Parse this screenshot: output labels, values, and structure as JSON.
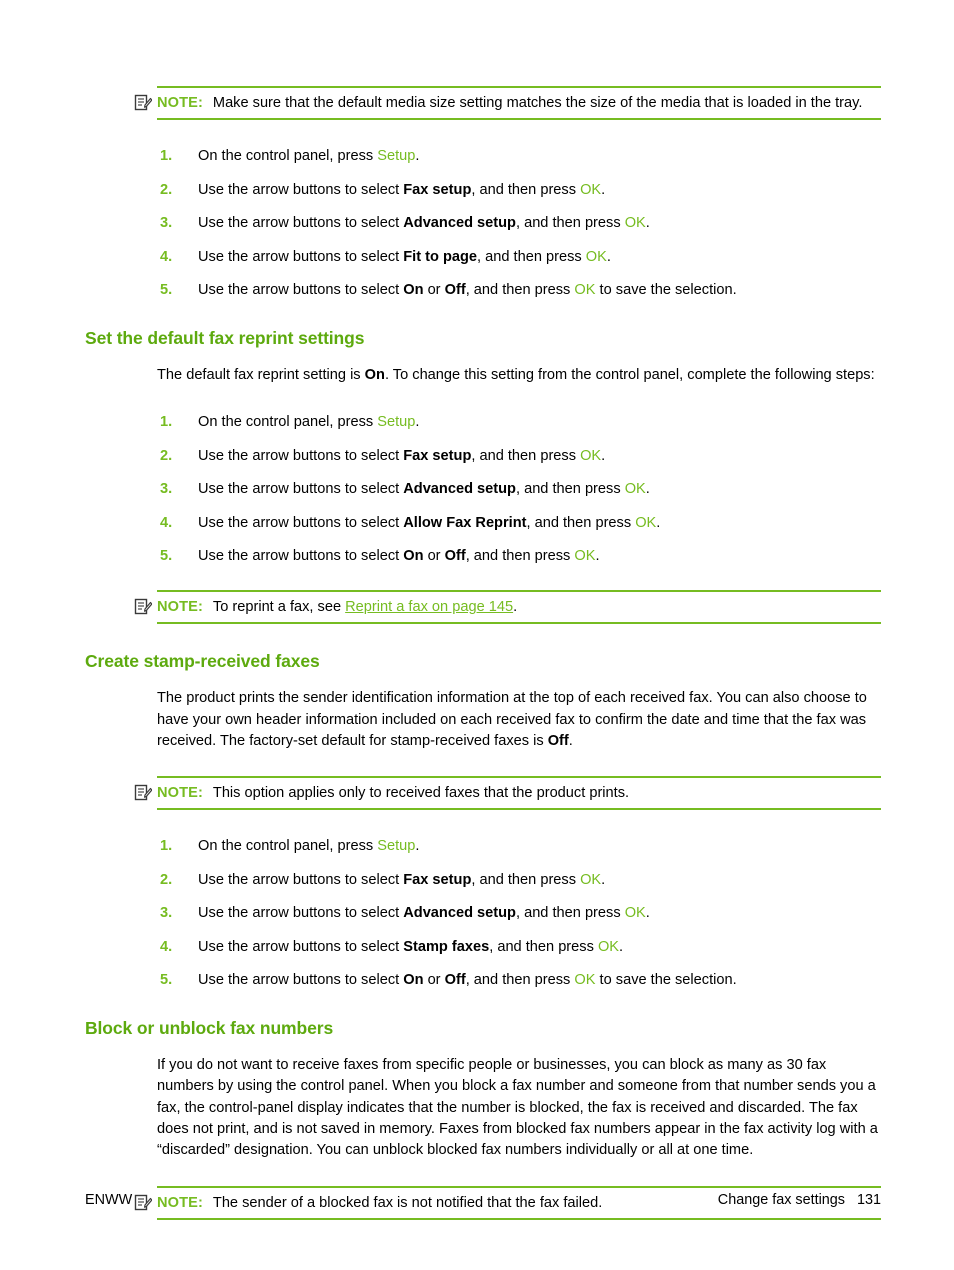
{
  "document": {
    "footer": {
      "left": "ENWW",
      "right": "Change fax settings   131"
    },
    "note_label": "NOTE:",
    "icon": "note-pencil-icon"
  },
  "blocks": {
    "note_media_size": {
      "label": "NOTE:",
      "text": "Make sure that the default media size setting matches the size of the media that is loaded in the tray."
    },
    "steps_fit_to_page": [
      {
        "num": "1.",
        "pre": "On the control panel, press ",
        "key": "Setup",
        "post": "."
      },
      {
        "num": "2.",
        "pre": "Use the arrow buttons to select ",
        "menu": "Fax setup",
        "mid": ", and then press ",
        "key": "OK",
        "post": "."
      },
      {
        "num": "3.",
        "pre": "Use the arrow buttons to select ",
        "menu": "Advanced setup",
        "mid": ", and then press ",
        "key": "OK",
        "post": "."
      },
      {
        "num": "4.",
        "pre": "Use the arrow buttons to select ",
        "menu": "Fit to page",
        "mid": ", and then press ",
        "key": "OK",
        "post": "."
      },
      {
        "num": "5.",
        "pre": "Use the arrow buttons to select ",
        "menu": "On",
        "mid2": " or ",
        "menu2": "Off",
        "mid": ", and then press ",
        "key": "OK",
        "post": " to save the selection."
      }
    ],
    "heading_reprint": "Set the default fax reprint settings",
    "body_reprint": {
      "pre": "The default fax reprint setting is ",
      "menu": "On",
      "post": ". To change this setting from the control panel, complete the following steps:"
    },
    "steps_reprint": [
      {
        "num": "1.",
        "pre": "On the control panel, press ",
        "key": "Setup",
        "post": "."
      },
      {
        "num": "2.",
        "pre": "Use the arrow buttons to select ",
        "menu": "Fax setup",
        "mid": ", and then press ",
        "key": "OK",
        "post": "."
      },
      {
        "num": "3.",
        "pre": "Use the arrow buttons to select ",
        "menu": "Advanced setup",
        "mid": ", and then press ",
        "key": "OK",
        "post": "."
      },
      {
        "num": "4.",
        "pre": "Use the arrow buttons to select ",
        "menu": "Allow Fax Reprint",
        "mid": ", and then press ",
        "key": "OK",
        "post": "."
      },
      {
        "num": "5.",
        "pre": "Use the arrow buttons to select ",
        "menu": "On",
        "mid2": " or ",
        "menu2": "Off",
        "mid": ", and then press ",
        "key": "OK",
        "post": "."
      }
    ],
    "note_reprint": {
      "label": "NOTE:",
      "pre": "To reprint a fax, see ",
      "link": "Reprint a fax on page 145",
      "post": "."
    },
    "heading_stamp": "Create stamp-received faxes",
    "body_stamp": {
      "pre": "The product prints the sender identification information at the top of each received fax. You can also choose to have your own header information included on each received fax to confirm the date and time that the fax was received. The factory-set default for stamp-received faxes is ",
      "menu": "Off",
      "post": "."
    },
    "note_stamp": {
      "label": "NOTE:",
      "text": "This option applies only to received faxes that the product prints."
    },
    "steps_stamp": [
      {
        "num": "1.",
        "pre": "On the control panel, press ",
        "key": "Setup",
        "post": "."
      },
      {
        "num": "2.",
        "pre": "Use the arrow buttons to select ",
        "menu": "Fax setup",
        "mid": ", and then press ",
        "key": "OK",
        "post": "."
      },
      {
        "num": "3.",
        "pre": "Use the arrow buttons to select ",
        "menu": "Advanced setup",
        "mid": ", and then press ",
        "key": "OK",
        "post": "."
      },
      {
        "num": "4.",
        "pre": "Use the arrow buttons to select ",
        "menu": "Stamp faxes",
        "mid": ", and then press ",
        "key": "OK",
        "post": "."
      },
      {
        "num": "5.",
        "pre": "Use the arrow buttons to select ",
        "menu": "On",
        "mid2": " or ",
        "menu2": "Off",
        "mid": ", and then press ",
        "key": "OK",
        "post": " to save the selection."
      }
    ],
    "heading_block": "Block or unblock fax numbers",
    "body_block": "If you do not want to receive faxes from specific people or businesses, you can block as many as 30 fax numbers by using the control panel. When you block a fax number and someone from that number sends you a fax, the control-panel display indicates that the number is blocked, the fax is received and discarded. The fax does not print, and is not saved in memory. Faxes from blocked fax numbers appear in the fax activity log with a “discarded” designation. You can unblock blocked fax numbers individually or all at one time.",
    "note_block": {
      "label": "NOTE:",
      "text": "The sender of a blocked fax is not notified that the fax failed."
    }
  },
  "colors": {
    "accent_green": "#76bc21",
    "heading_green": "#5daa0e",
    "text_black": "#000000"
  }
}
